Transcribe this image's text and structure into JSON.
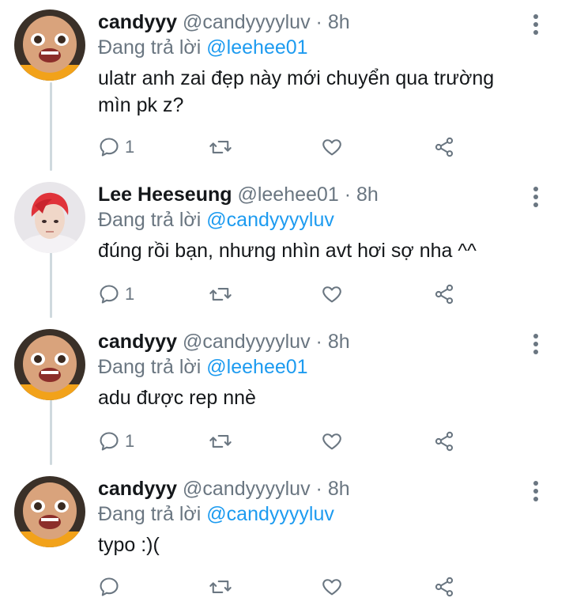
{
  "tweets": [
    {
      "name": "candyyy",
      "handle": "@candyyyyluv",
      "dot": "·",
      "time": "8h",
      "reply_prefix": "Đang trả lời",
      "reply_to": "@leehee01",
      "text_lines": [
        "ulatr anh zai đẹp này mới chuyển qua trường",
        "mìn pk z?"
      ],
      "reply_count": "1",
      "avatar": "baby-face-avatar"
    },
    {
      "name": "Lee Heeseung",
      "handle": "@leehee01",
      "dot": "·",
      "time": "8h",
      "reply_prefix": "Đang trả lời",
      "reply_to": "@candyyyyluv",
      "text_lines": [
        "đúng rồi bạn, nhưng nhìn avt hơi sợ nha ^^"
      ],
      "reply_count": "1",
      "avatar": "red-hair-avatar"
    },
    {
      "name": "candyyy",
      "handle": "@candyyyyluv",
      "dot": "·",
      "time": "8h",
      "reply_prefix": "Đang trả lời",
      "reply_to": "@leehee01",
      "text_lines": [
        "adu được rep nnè"
      ],
      "reply_count": "1",
      "avatar": "baby-face-avatar"
    },
    {
      "name": "candyyy",
      "handle": "@candyyyyluv",
      "dot": "·",
      "time": "8h",
      "reply_prefix": "Đang trả lời",
      "reply_to": "@candyyyyluv",
      "text_lines": [
        "typo :)("
      ],
      "reply_count": "",
      "avatar": "baby-face-avatar"
    }
  ],
  "colors": {
    "text": "#14171a",
    "secondary": "#6a7681",
    "mention": "#1d9bf0",
    "thread_line": "#cfd9de"
  }
}
